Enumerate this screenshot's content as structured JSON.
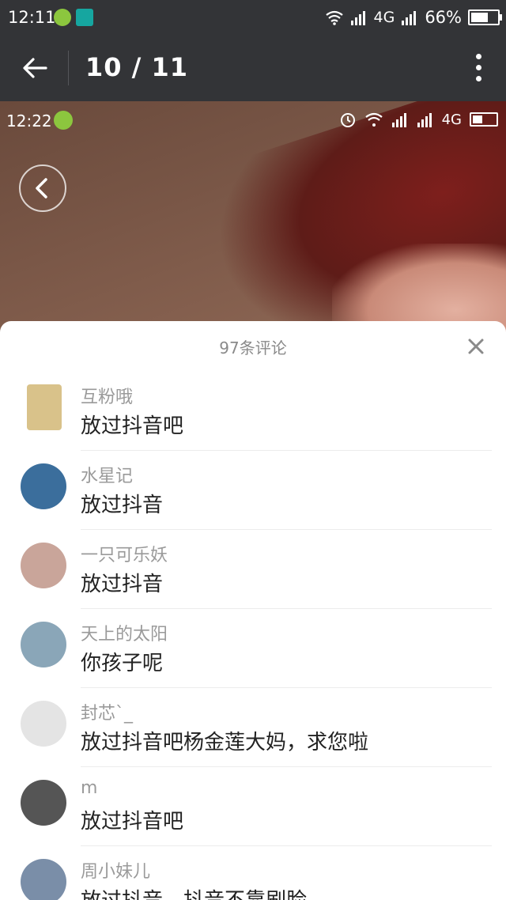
{
  "status_bar": {
    "time": "12:11",
    "network": "4G",
    "battery": "66%",
    "battery_level": 0.66,
    "icons": [
      "plus-badge-icon",
      "screenshot-icon",
      "wifi-icon",
      "signal-icon",
      "signal-icon",
      "battery-icon"
    ]
  },
  "toolbar": {
    "counter": "10 / 11",
    "back_icon": "arrow-left-icon",
    "more_icon": "more-vertical-icon"
  },
  "screenshot": {
    "status": {
      "time": "12:22",
      "network": "4G"
    },
    "back_icon": "chevron-left-icon"
  },
  "comments_sheet": {
    "title": "97条评论",
    "close_icon": "close-icon",
    "items": [
      {
        "name": "互粉哦",
        "text": "放过抖音吧",
        "avatar_color": "#d9c28a"
      },
      {
        "name": "水星记",
        "text": "放过抖音",
        "avatar_color": "#3b6e9c"
      },
      {
        "name": "一只可乐妖",
        "text": "放过抖音",
        "avatar_color": "#c9a59a"
      },
      {
        "name": "天上的太阳",
        "text": "你孩子呢",
        "avatar_color": "#8aa6b8"
      },
      {
        "name": "封芯`_",
        "text": "放过抖音吧杨金莲大妈，求您啦",
        "avatar_color": "#e4e4e4"
      },
      {
        "name": "m",
        "text": "放过抖音吧",
        "avatar_color": "#555555"
      },
      {
        "name": "周小妹儿",
        "text": "放过抖音，抖音不靠刷脸",
        "avatar_color": "#7a8ea8"
      }
    ]
  },
  "colors": {
    "toolbar_bg": "#333437",
    "sheet_bg": "#ffffff",
    "name_gray": "#9a9a9a",
    "text_dark": "#222222"
  }
}
